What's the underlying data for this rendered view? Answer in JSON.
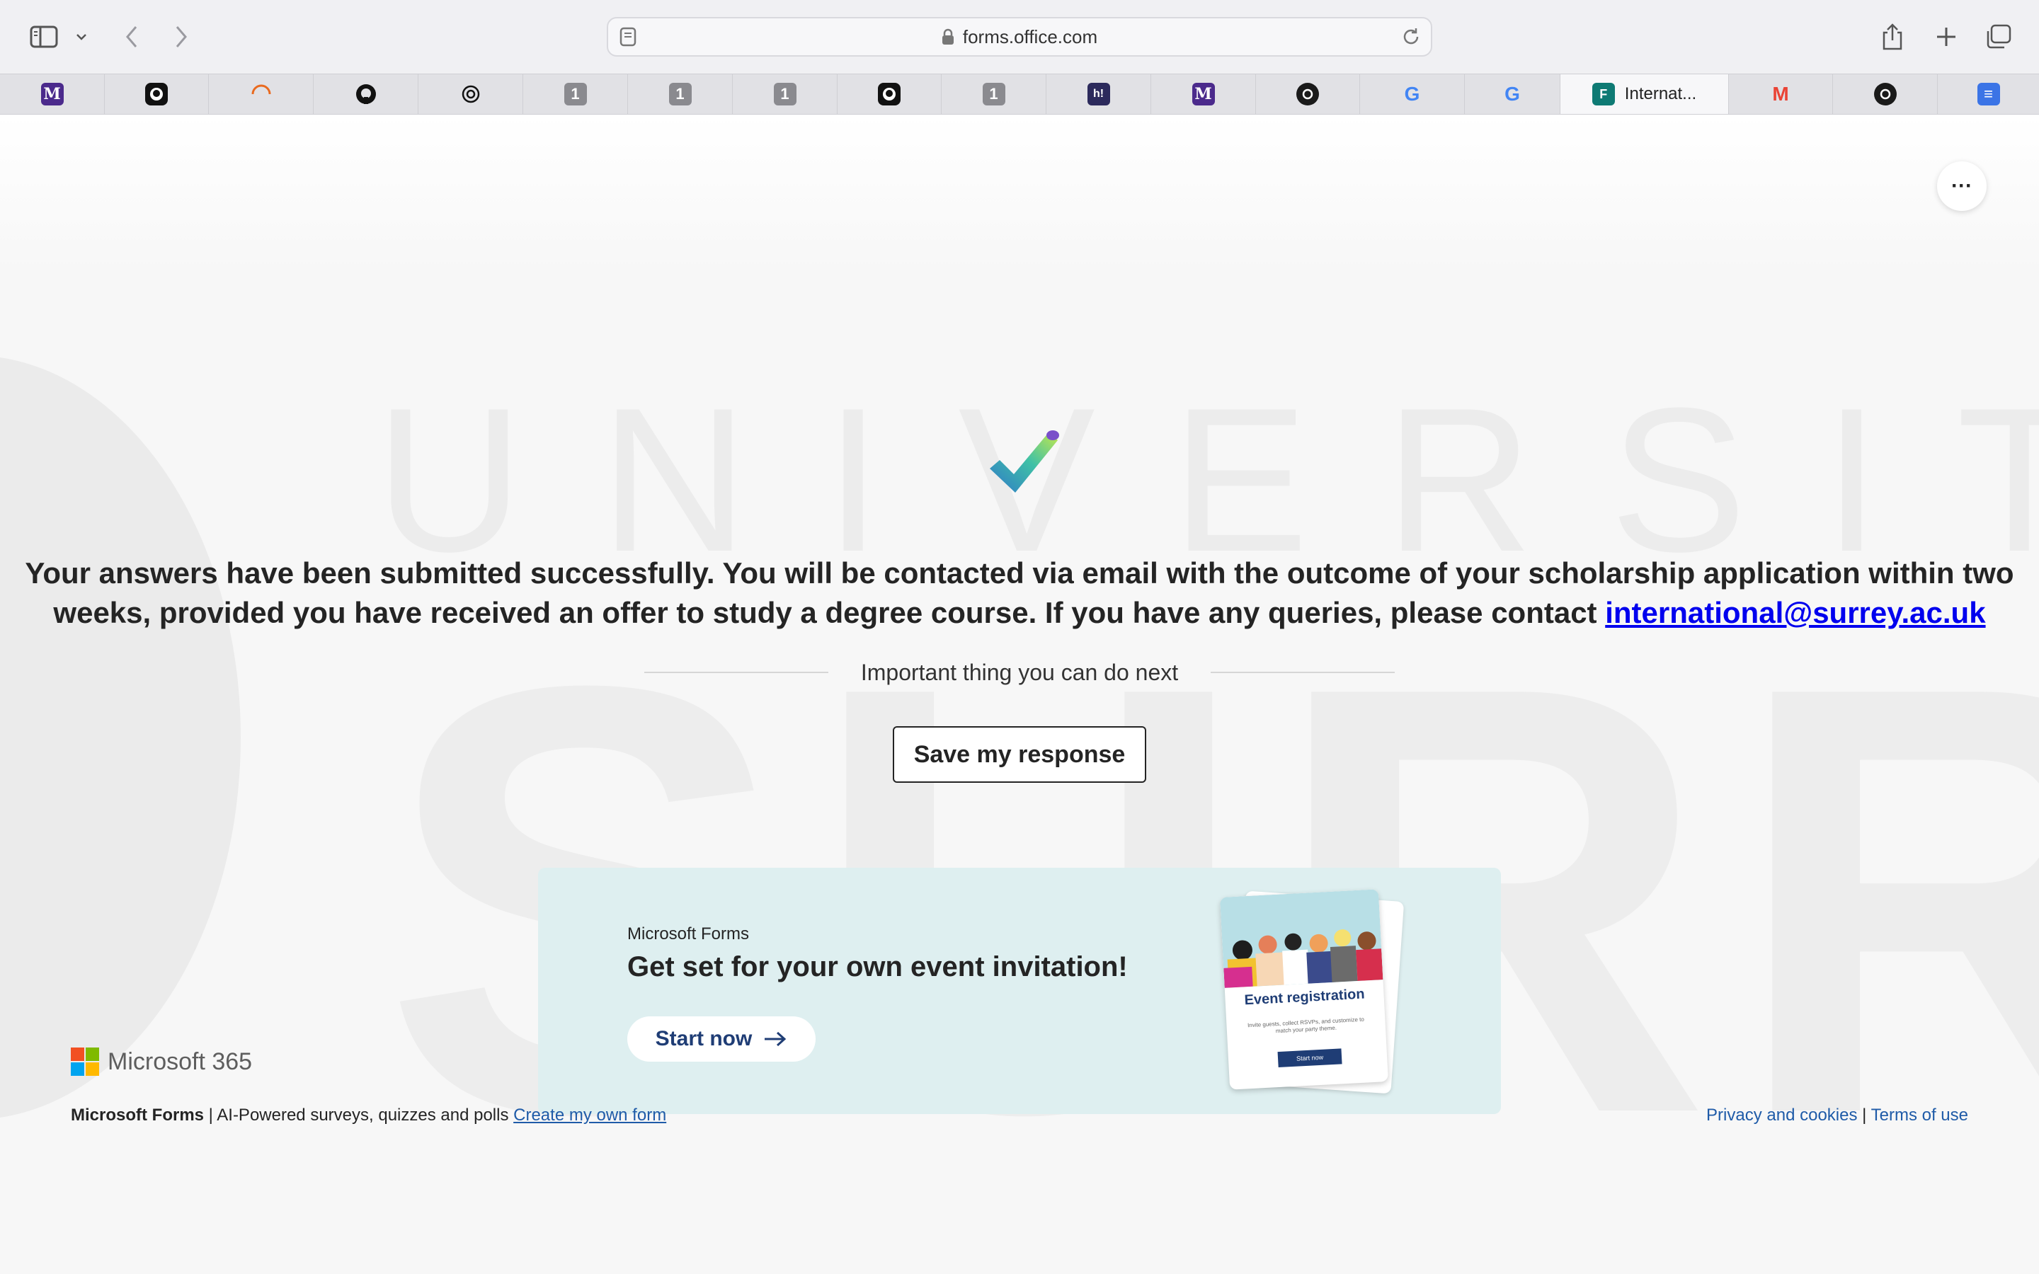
{
  "browser": {
    "address": "forms.office.com",
    "tabs": [
      {
        "icon": "medium-icon",
        "glyph": "M",
        "color": "#4b2a8c"
      },
      {
        "icon": "github-icon",
        "glyph": "",
        "color": "#111111"
      },
      {
        "icon": "loading-icon",
        "glyph": "",
        "color": "#e96a1f"
      },
      {
        "icon": "github-icon",
        "glyph": "",
        "color": "#111111"
      },
      {
        "icon": "openai-icon",
        "glyph": "",
        "color": "#111111"
      },
      {
        "icon": "onepassword-icon",
        "glyph": "1",
        "color": "#8a8a8f"
      },
      {
        "icon": "onepassword-icon",
        "glyph": "1",
        "color": "#8a8a8f"
      },
      {
        "icon": "onepassword-icon",
        "glyph": "1",
        "color": "#8a8a8f"
      },
      {
        "icon": "github-icon",
        "glyph": "",
        "color": "#111111"
      },
      {
        "icon": "onepassword-icon",
        "glyph": "1",
        "color": "#8a8a8f"
      },
      {
        "icon": "hashnode-icon",
        "glyph": "h!",
        "color": "#2c2a5c"
      },
      {
        "icon": "medium-icon",
        "glyph": "M",
        "color": "#4b2a8c"
      },
      {
        "icon": "cursor-icon",
        "glyph": "",
        "color": "#1a1a1a"
      },
      {
        "icon": "google-icon",
        "glyph": "G",
        "color": "#4285f4"
      },
      {
        "icon": "google-icon",
        "glyph": "G",
        "color": "#4285f4"
      },
      {
        "icon": "forms-icon",
        "glyph": "F",
        "color": "#0e7a74",
        "title": "Internat..."
      },
      {
        "icon": "gmail-icon",
        "glyph": "M",
        "color": "#ea4335"
      },
      {
        "icon": "cursor-icon",
        "glyph": "",
        "color": "#1a1a1a"
      },
      {
        "icon": "docs-icon",
        "glyph": "≡",
        "color": "#3b74e6"
      }
    ]
  },
  "page": {
    "watermark_top": "UNIVERSITY",
    "watermark_bottom": "SURREY",
    "message_main": "Your answers have been submitted successfully. You will be contacted via email with the outcome of your scholarship application within two weeks, provided you have received an offer to study a degree course. If you have any queries, please contact ",
    "message_email": "international@surrey.ac.uk",
    "next_label": "Important thing you can do next",
    "save_button": "Save my response",
    "more_label": "···"
  },
  "promo": {
    "brand": "Microsoft Forms",
    "title": "Get set for your own event invitation!",
    "button": "Start now",
    "card_title": "Event registration",
    "card_sub": "Invite guests, collect RSVPs, and customize to match your party theme.",
    "card_button": "Start now"
  },
  "footer": {
    "brand": "Microsoft 365",
    "product": "Microsoft Forms",
    "tagline": " | AI-Powered surveys, quizzes and polls ",
    "create_link": "Create my own form",
    "privacy": "Privacy and cookies",
    "separator": " | ",
    "terms": "Terms of use"
  }
}
